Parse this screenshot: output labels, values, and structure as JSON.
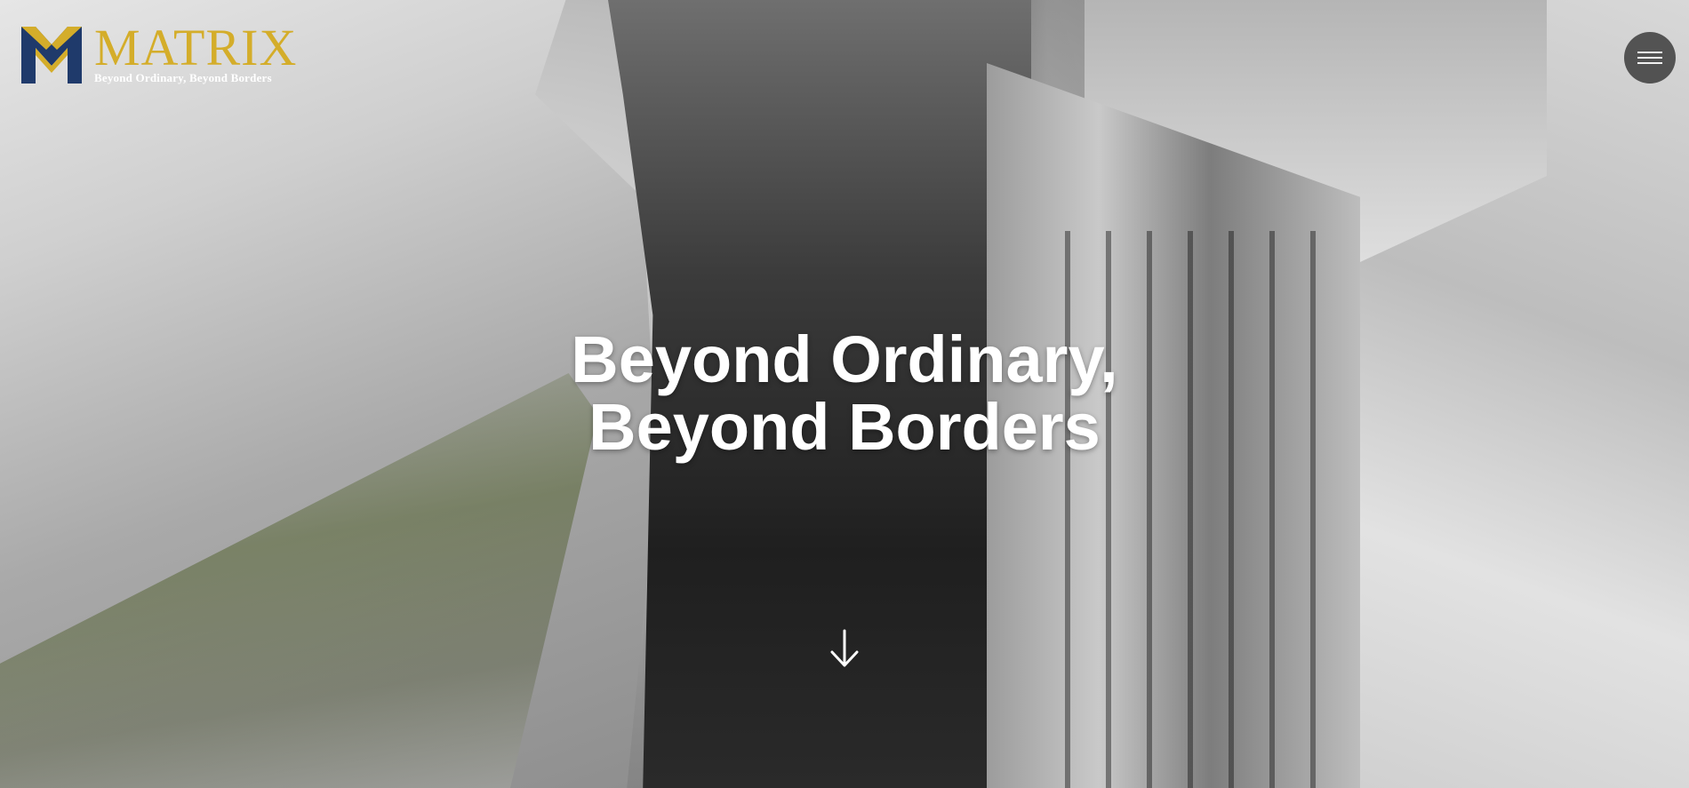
{
  "brand": {
    "name": "MATRIX",
    "tagline": "Beyond Ordinary, Beyond Borders",
    "brand_gold": "#d4ad2a",
    "brand_navy": "#1f3a6b"
  },
  "hero": {
    "headline_line1": "Beyond Ordinary,",
    "headline_line2": "Beyond Borders"
  },
  "controls": {
    "menu_icon": "hamburger-menu-icon",
    "scroll_icon": "arrow-down-icon"
  }
}
